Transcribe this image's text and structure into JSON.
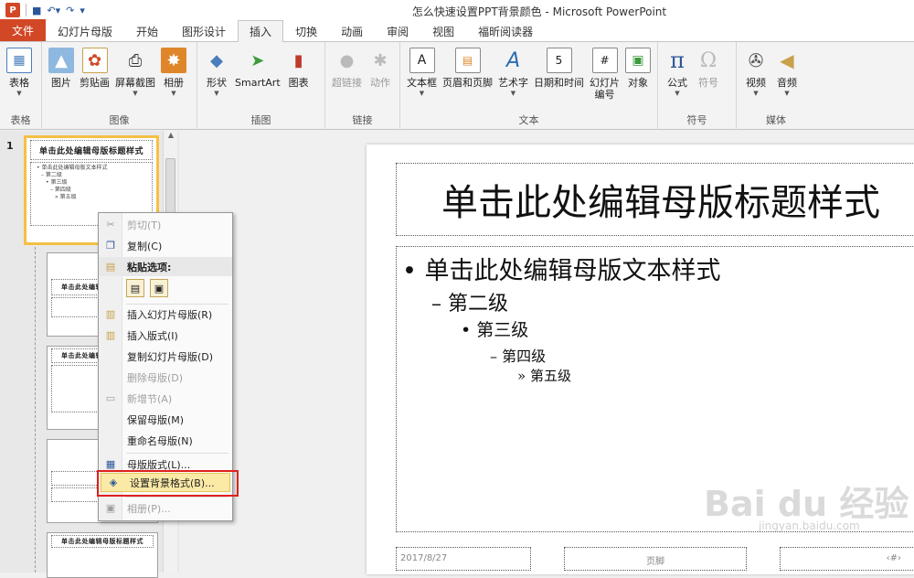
{
  "window": {
    "title": "怎么快速设置PPT背景颜色 - Microsoft PowerPoint"
  },
  "tabs": {
    "file": "文件",
    "items": [
      "幻灯片母版",
      "开始",
      "图形设计",
      "插入",
      "切换",
      "动画",
      "审阅",
      "视图",
      "福昕阅读器"
    ],
    "active": "插入"
  },
  "ribbon": {
    "table": {
      "label": "表格",
      "group": "表格"
    },
    "images": {
      "picture": "图片",
      "clipart": "剪贴画",
      "screenshot": "屏幕截图",
      "album": "相册",
      "group": "图像"
    },
    "illus": {
      "shapes": "形状",
      "smartart": "SmartArt",
      "chart": "图表",
      "group": "插图"
    },
    "links": {
      "hyperlink": "超链接",
      "action": "动作",
      "group": "链接"
    },
    "text": {
      "textbox": "文本框",
      "headerfooter": "页眉和页脚",
      "wordart": "艺术字",
      "datetime": "日期和时间",
      "slidenum_1": "幻灯片",
      "slidenum_2": "编号",
      "object": "对象",
      "group": "文本"
    },
    "symbols": {
      "equation": "公式",
      "symbol": "符号",
      "group": "符号"
    },
    "media": {
      "video": "视频",
      "audio": "音频",
      "group": "媒体"
    }
  },
  "thumbnails": {
    "number": "1",
    "title": "单击此处编辑母版标题样式",
    "body": [
      "• 单击此处编辑母版文本样式",
      "– 第二级",
      "• 第三级",
      "– 第四级",
      "» 第五级"
    ]
  },
  "slide": {
    "title": "单击此处编辑母版标题样式",
    "levels": [
      "• 单击此处编辑母版文本样式",
      "– 第二级",
      "• 第三级",
      "– 第四级",
      "» 第五级"
    ],
    "date": "2017/8/27",
    "footer": "页脚",
    "number": "‹#›"
  },
  "context_menu": {
    "cut": "剪切(T)",
    "copy": "复制(C)",
    "paste_header": "粘贴选项:",
    "insert_master": "插入幻灯片母版(R)",
    "insert_layout": "插入版式(I)",
    "duplicate_master": "复制幻灯片母版(D)",
    "delete_master": "删除母版(D)",
    "new_section": "新增节(A)",
    "preserve_master": "保留母版(M)",
    "rename_master": "重命名母版(N)",
    "master_layout": "母版版式(L)...",
    "format_background": "设置背景格式(B)...",
    "album": "相册(P)..."
  },
  "watermark": {
    "brand": "Bai du 经验",
    "url": "jingyan.baidu.com"
  },
  "colors": {
    "file_tab": "#d24726",
    "selected_thumb": "#f5c043",
    "menu_highlight": "#fbe9a6",
    "callout": "#e0201b"
  }
}
